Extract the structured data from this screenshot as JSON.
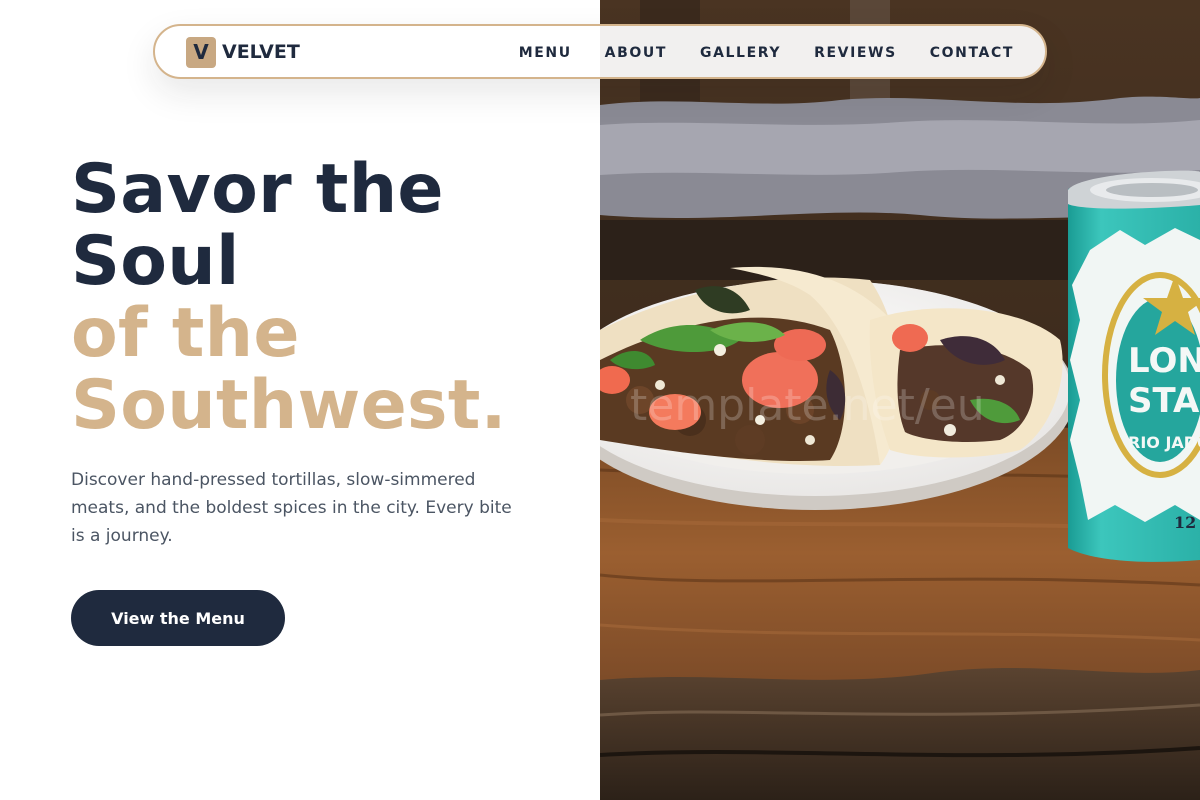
{
  "brand": {
    "mark": "V",
    "name": "VELVET"
  },
  "nav": {
    "links": [
      "MENU",
      "ABOUT",
      "GALLERY",
      "REVIEWS",
      "CONTACT"
    ]
  },
  "hero": {
    "headline_line1": "Savor the",
    "headline_line2": "Soul",
    "headline_line3": "of the",
    "headline_line4": "Southwest.",
    "description": "Discover hand-pressed tortillas, slow-simmered meats, and the boldest spices in the city. Every bite is a journey.",
    "cta_label": "View the Menu",
    "image_alt": "Tacos on a white plate beside a Lone Star beer can on a rustic wooden table"
  },
  "can_label": {
    "brand_a": "LONE",
    "brand_b": "STAR",
    "sub": "RIO JADO",
    "size": "12"
  },
  "colors": {
    "navy": "#1f2a3e",
    "gold": "#d4b48c",
    "text_gray": "#4b5563",
    "logo_tile": "#c8a882"
  }
}
